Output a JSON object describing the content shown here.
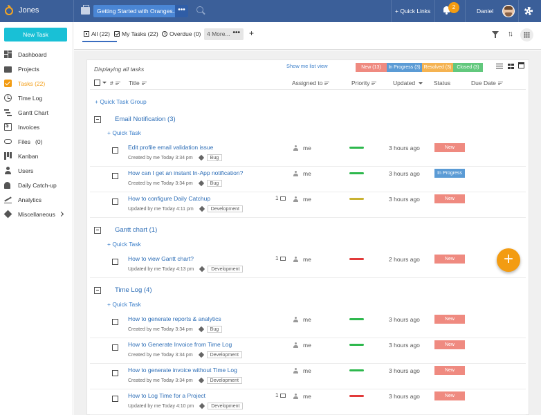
{
  "topbar": {
    "brand": "Jones",
    "project": "Getting Started with Oranges...",
    "project_more": "•••",
    "quick_links": "+ Quick Links",
    "notification_count": "2",
    "user": "Daniel"
  },
  "sidebar": {
    "new_task": "New Task",
    "items": [
      {
        "label": "Dashboard"
      },
      {
        "label": "Projects"
      },
      {
        "label": "Tasks (22)"
      },
      {
        "label": "Time Log"
      },
      {
        "label": "Gantt Chart"
      },
      {
        "label": "Invoices"
      },
      {
        "label": "Files   (0)"
      },
      {
        "label": "Kanban"
      },
      {
        "label": "Users"
      },
      {
        "label": "Daily Catch-up"
      },
      {
        "label": "Analytics"
      },
      {
        "label": "Miscellaneous"
      }
    ]
  },
  "subheader": {
    "tab_all": "All (22)",
    "tab_my": "My Tasks (22)",
    "tab_overdue": "Overdue (0)",
    "tab_more": "4 More...",
    "add_tab": "+"
  },
  "panel": {
    "displaying": "Displaying all tasks",
    "show_me": "Show me list view",
    "status_filters": [
      {
        "label": "New (13)",
        "color": "#ef8a80"
      },
      {
        "label": "In Progress (3)",
        "color": "#5b9bd5"
      },
      {
        "label": "Resolved (3)",
        "color": "#f5b351"
      },
      {
        "label": "Closed (3)",
        "color": "#62c87d"
      }
    ],
    "columns": {
      "hash": "#",
      "title": "Title",
      "assigned": "Assigned to",
      "priority": "Priority",
      "updated": "Updated",
      "status": "Status",
      "due": "Due Date"
    },
    "quick_task_group": "+ Quick Task Group",
    "quick_task": "+ Quick Task",
    "groups": [
      {
        "name": "Email Notification (3)"
      },
      {
        "name": "Gantt chart (1)"
      },
      {
        "name": "Time Log (4)"
      }
    ],
    "tasks": [
      {
        "title": "Edit profile email validation issue",
        "meta": "Created by me Today 3:34 pm",
        "tag": "Bug",
        "comments": "",
        "assigned": "me",
        "updated": "3 hours ago",
        "status": "New",
        "status_color": "#ef8a80",
        "priority_color": "#2db84d"
      },
      {
        "title": "How can I get an instant In-App notification?",
        "meta": "Created by me Today 3:34 pm",
        "tag": "Bug",
        "comments": "",
        "assigned": "me",
        "updated": "3 hours ago",
        "status": "In Progress",
        "status_color": "#5b9bd5",
        "priority_color": "#2db84d"
      },
      {
        "title": "How to configure Daily Catchup",
        "meta": "Updated by me Today 4:11 pm",
        "tag": "Development",
        "comments": "1",
        "assigned": "me",
        "updated": "3 hours ago",
        "status": "New",
        "status_color": "#ef8a80",
        "priority_color": "#c9b232"
      },
      {
        "title": "How to view Gantt chart?",
        "meta": "Updated by me Today 4:13 pm",
        "tag": "Development",
        "comments": "1",
        "assigned": "me",
        "updated": "2 hours ago",
        "status": "New",
        "status_color": "#ef8a80",
        "priority_color": "#e23a3a"
      },
      {
        "title": "How to generate reports & analytics",
        "meta": "Created by me Today 3:34 pm",
        "tag": "Bug",
        "comments": "",
        "assigned": "me",
        "updated": "3 hours ago",
        "status": "New",
        "status_color": "#ef8a80",
        "priority_color": "#2db84d"
      },
      {
        "title": "How to Generate Invoice from Time Log",
        "meta": "Created by me Today 3:34 pm",
        "tag": "Development",
        "comments": "",
        "assigned": "me",
        "updated": "3 hours ago",
        "status": "New",
        "status_color": "#ef8a80",
        "priority_color": "#2db84d"
      },
      {
        "title": "How to generate invoice without Time Log",
        "meta": "Created by me Today 3:34 pm",
        "tag": "Development",
        "comments": "",
        "assigned": "me",
        "updated": "3 hours ago",
        "status": "New",
        "status_color": "#ef8a80",
        "priority_color": "#2db84d"
      },
      {
        "title": "How to Log Time for a Project",
        "meta": "Updated by me Today 4:10 pm",
        "tag": "Development",
        "comments": "1",
        "assigned": "me",
        "updated": "3 hours ago",
        "status": "New",
        "status_color": "#ef8a80",
        "priority_color": "#e23a3a"
      }
    ]
  },
  "fab": "+"
}
